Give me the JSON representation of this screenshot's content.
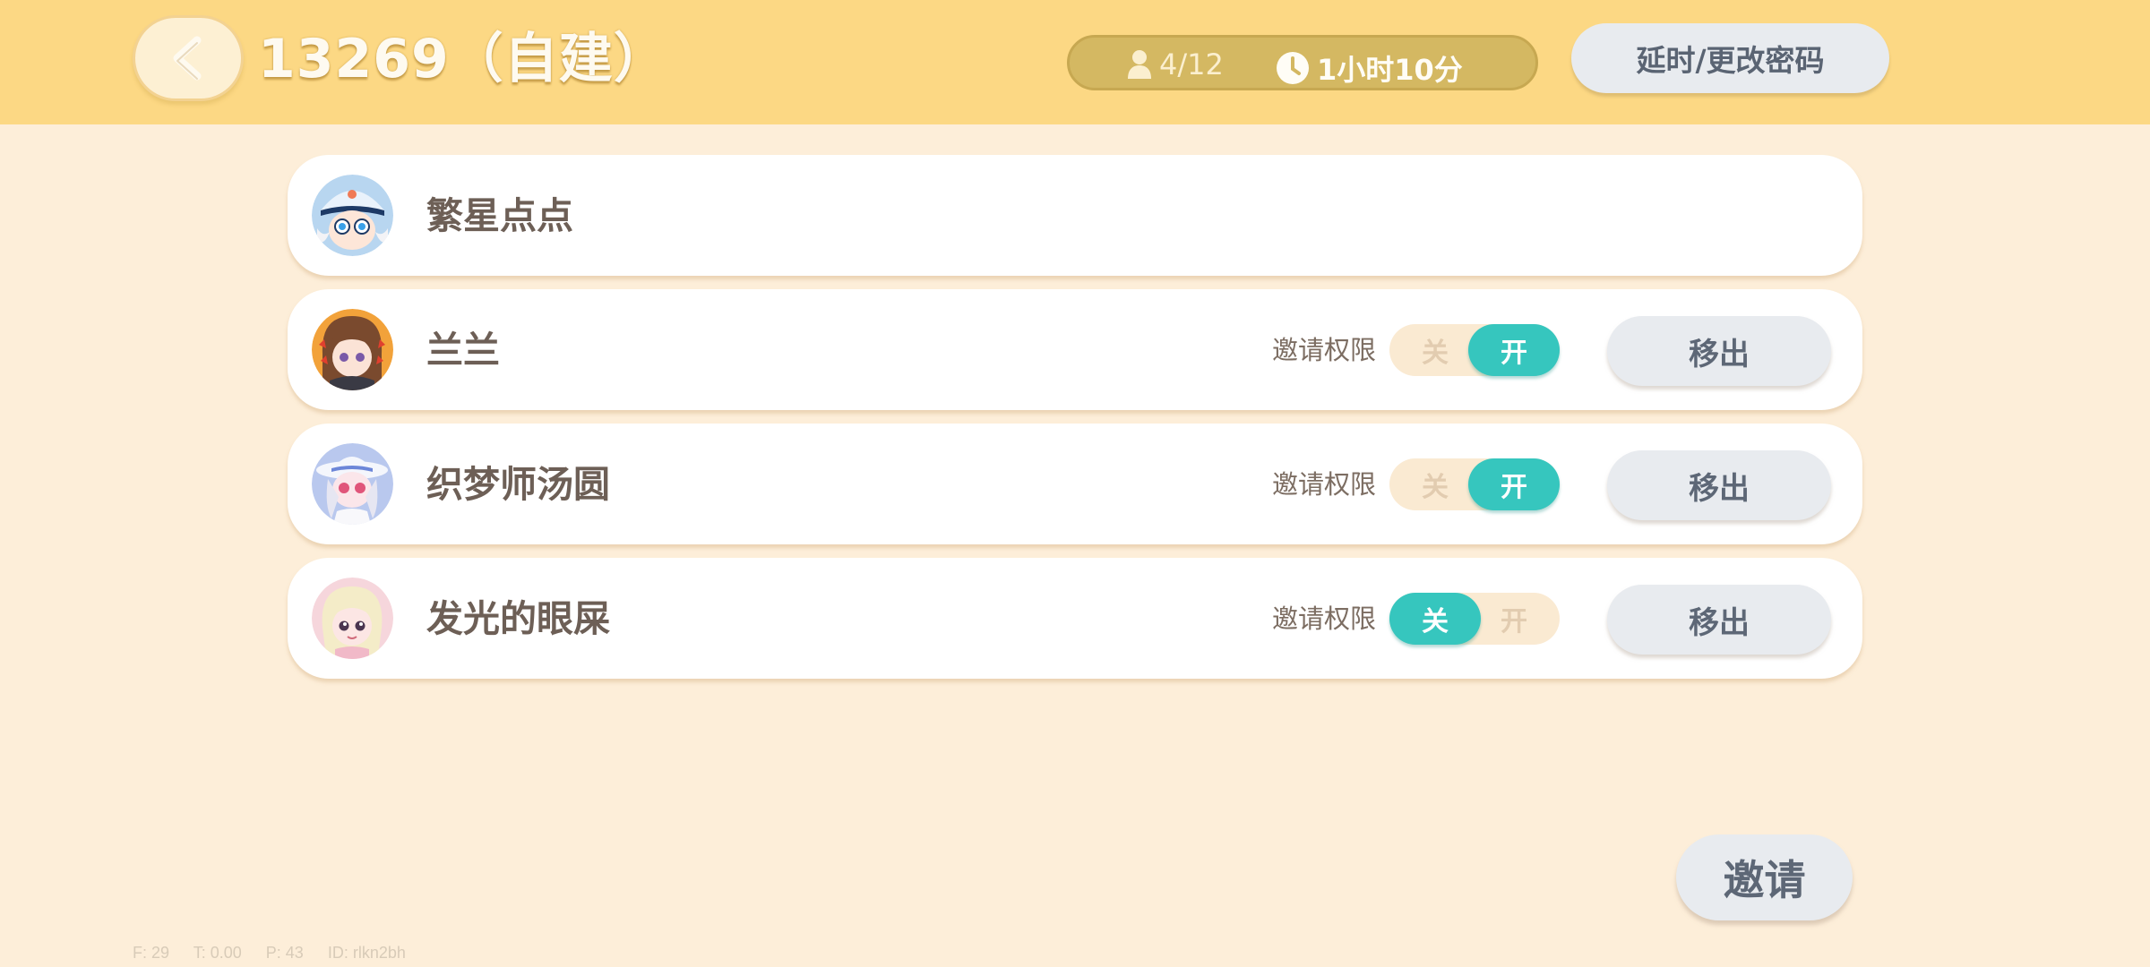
{
  "header": {
    "title": "13269（自建）",
    "players": "4/12",
    "timer": "1小时10分",
    "extend_label": "延时/更改密码"
  },
  "members": [
    {
      "name": "繁星点点",
      "avatar": "avatar-blue-hat",
      "has_controls": false
    },
    {
      "name": "兰兰",
      "avatar": "avatar-brown-hair",
      "has_controls": true,
      "perm_label": "邀请权限",
      "off_label": "关",
      "on_label": "开",
      "state": "on",
      "remove_label": "移出"
    },
    {
      "name": "织梦师汤圆",
      "avatar": "avatar-white-hat",
      "has_controls": true,
      "perm_label": "邀请权限",
      "off_label": "关",
      "on_label": "开",
      "state": "on",
      "remove_label": "移出"
    },
    {
      "name": "发光的眼屎",
      "avatar": "avatar-blonde",
      "has_controls": true,
      "perm_label": "邀请权限",
      "off_label": "关",
      "on_label": "开",
      "state": "off",
      "remove_label": "移出"
    }
  ],
  "invite_label": "邀请",
  "debug": {
    "f": "F: 29",
    "t": "T: 0.00",
    "p": "P: 43",
    "id": "ID: rlkn2bh"
  },
  "colors": {
    "topbar": "#fcd884",
    "background": "#fdeed9",
    "toggle_active": "#36c6be",
    "button": "#e8ebef"
  }
}
